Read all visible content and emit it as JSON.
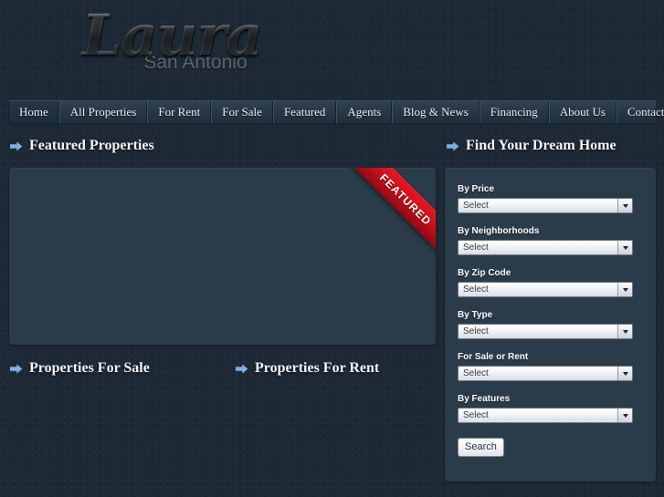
{
  "site": {
    "logo_main": "Laura",
    "logo_sub": "San Antonio"
  },
  "nav": {
    "items": [
      {
        "label": "Home",
        "active": true
      },
      {
        "label": "All Properties",
        "active": false
      },
      {
        "label": "For Rent",
        "active": false
      },
      {
        "label": "For Sale",
        "active": false
      },
      {
        "label": "Featured",
        "active": false
      },
      {
        "label": "Agents",
        "active": false
      },
      {
        "label": "Blog & News",
        "active": false
      },
      {
        "label": "Financing",
        "active": false
      },
      {
        "label": "About Us",
        "active": false
      },
      {
        "label": "Contact Us",
        "active": false
      }
    ]
  },
  "sections": {
    "featured_properties": "Featured Properties",
    "find_your_dream_home": "Find Your Dream Home",
    "properties_for_sale": "Properties For Sale",
    "properties_for_rent": "Properties For Rent"
  },
  "featured_box": {
    "ribbon_label": "FEATURED"
  },
  "search_form": {
    "fields": [
      {
        "label": "By Price",
        "value": "Select"
      },
      {
        "label": "By Neighborhoods",
        "value": "Select"
      },
      {
        "label": "By Zip Code",
        "value": "Select"
      },
      {
        "label": "By Type",
        "value": "Select"
      },
      {
        "label": "For Sale or Rent",
        "value": "Select"
      },
      {
        "label": "By Features",
        "value": "Select"
      }
    ],
    "submit_label": "Search"
  },
  "colors": {
    "page_bg": "#1d2935",
    "panel_bg": "#2a3b49",
    "nav_bg": "#263746",
    "accent_arrow": "#7fb0e0",
    "ribbon_red": "#c5101c",
    "heading_text": "#f2f6fa"
  },
  "icons": {
    "arrow_right": "arrow-right-icon",
    "chevron_down": "chevron-down-icon"
  }
}
